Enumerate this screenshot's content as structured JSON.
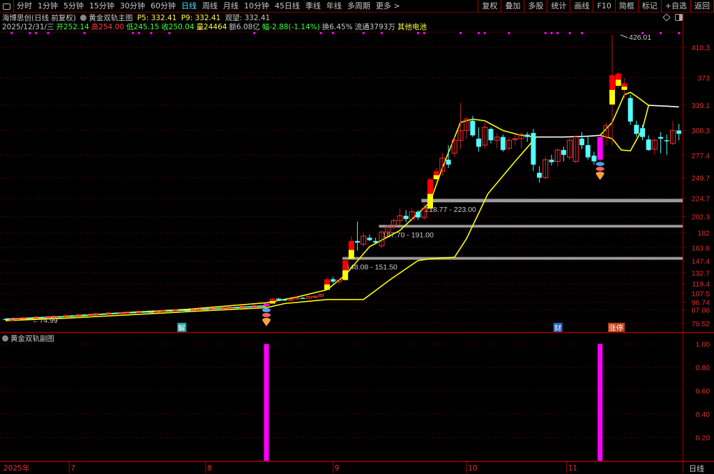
{
  "toolbar": {
    "periods": [
      "分时",
      "1分钟",
      "5分钟",
      "15分钟",
      "30分钟",
      "60分钟",
      "日线",
      "周线",
      "月线",
      "10分钟",
      "45日线",
      "季线",
      "年线",
      "多周期",
      "更多 >"
    ],
    "active": "日线",
    "actions": [
      "复权",
      "叠加",
      "多股",
      "统计",
      "画线",
      "F10",
      "简框",
      "标记",
      "+自选",
      "返回"
    ]
  },
  "header": {
    "stock": "海博思创(日线 前复权)",
    "indicator": "黄金双轨主图",
    "p5": "P5: 332.41",
    "p9": "P9: 332.41",
    "watch": "观望: 332.41",
    "date": "2025/12/31/三",
    "open": "开252.14",
    "high": "高254.00",
    "low": "低245.15",
    "close": "收250.04",
    "volume": "量24464",
    "amount": "额6.08亿",
    "change": "幅-2.88(-1.14%)",
    "turnover": "换6.45%",
    "float": "流通3793万",
    "concept": "其他电池"
  },
  "price_axis": {
    "ticks": [
      410.3,
      373.0,
      339.1,
      308.3,
      277.4,
      249.7,
      224.7,
      202.3,
      182.0,
      163.8,
      147.4,
      132.7,
      119.4,
      107.5,
      96.74,
      87.06,
      70.52
    ],
    "scale": "linear"
  },
  "sub_chart": {
    "title": "黄金双轨副图",
    "ticks": [
      "1.00",
      "0.80",
      "0.60",
      "0.40",
      "0.20"
    ],
    "bar_value": 1.0,
    "bar_indices": [
      43,
      98
    ],
    "bar_color": "#ff00ff"
  },
  "time_axis": {
    "labels": [
      {
        "text": "2025年",
        "i": -1
      },
      {
        "text": "7",
        "i": 10.5
      },
      {
        "text": "8",
        "i": 33
      },
      {
        "text": "9",
        "i": 54
      },
      {
        "text": "10",
        "i": 76
      },
      {
        "text": "11",
        "i": 92.5
      }
    ],
    "period": "日线"
  },
  "annotations": {
    "low": "←74.99",
    "high": "426.01",
    "events": [
      {
        "text": "解",
        "i": 29,
        "color": "#20a0a0"
      },
      {
        "text": "财",
        "i": 91,
        "color": "#2060c0"
      },
      {
        "text": "涨停",
        "i": 100,
        "color": "#c04010"
      }
    ]
  },
  "zones": [
    {
      "label": "148.08 - 151.50",
      "low": 148.08,
      "high": 151.5,
      "from": 56
    },
    {
      "label": "187.70 - 191.00",
      "low": 187.7,
      "high": 191.0,
      "from": 62
    },
    {
      "label": "218.77 - 223.00",
      "low": 218.77,
      "high": 223.0,
      "from": 69
    }
  ],
  "colors": {
    "up": "#ff3232",
    "down": "#54fcfc",
    "signal_top": "#ff0000",
    "signal_bottom": "#ffff00",
    "magenta": "#ff00ff",
    "band": "#ffff00",
    "watch_line": "#ffffff",
    "grid": "#8a0000",
    "axis_text": "#e03030"
  },
  "signal_dots": [
    1,
    4,
    5,
    7,
    13,
    21,
    22,
    24,
    27,
    41,
    52,
    54,
    59,
    62,
    68,
    69,
    75,
    78,
    79,
    83,
    89,
    90,
    91,
    93,
    95,
    105,
    108,
    111
  ],
  "signals": {
    "red_yellow": [
      44,
      53,
      56,
      57,
      70,
      71,
      100,
      101,
      102
    ],
    "magenta": [
      43,
      98
    ]
  },
  "candles": [
    [
      76,
      77,
      75,
      75.5
    ],
    [
      75.5,
      76,
      74.99,
      75.8
    ],
    [
      75.8,
      77,
      75.5,
      76.5
    ],
    [
      76.5,
      78,
      76,
      77.5
    ],
    [
      77.5,
      78,
      76.5,
      77
    ],
    [
      77,
      79,
      76.8,
      78.5
    ],
    [
      78.5,
      79,
      77.5,
      78
    ],
    [
      78,
      79.5,
      77.8,
      79
    ],
    [
      79,
      80,
      78.5,
      79.5
    ],
    [
      79.5,
      80,
      78.8,
      79.2
    ],
    [
      79.2,
      81,
      79,
      80.5
    ],
    [
      80.5,
      81,
      80,
      80.2
    ],
    [
      80.2,
      82,
      80,
      81.5
    ],
    [
      81.5,
      82,
      80.8,
      81
    ],
    [
      81,
      82.5,
      80.8,
      82
    ],
    [
      82,
      83,
      81.5,
      82.5
    ],
    [
      82.5,
      83,
      81.8,
      82
    ],
    [
      82,
      84,
      81.8,
      83.5
    ],
    [
      83.5,
      84,
      82.5,
      83
    ],
    [
      83,
      84.5,
      82.8,
      84
    ],
    [
      84,
      85,
      83.5,
      84.5
    ],
    [
      84.5,
      85,
      83.8,
      84
    ],
    [
      84,
      86,
      83.8,
      85.5
    ],
    [
      85.5,
      86,
      84.5,
      85
    ],
    [
      85,
      86,
      84,
      84.5
    ],
    [
      84.5,
      86.5,
      84.2,
      86
    ],
    [
      86,
      87,
      85.5,
      86.5
    ],
    [
      86.5,
      87,
      85.5,
      86
    ],
    [
      86,
      88,
      85.8,
      87.5
    ],
    [
      87.5,
      88,
      86.5,
      87
    ],
    [
      87,
      88,
      86,
      86.5
    ],
    [
      86.5,
      88.5,
      86.2,
      88
    ],
    [
      88,
      89,
      87.5,
      88.5
    ],
    [
      88.5,
      89,
      87.5,
      88
    ],
    [
      88,
      90,
      87.8,
      89.5
    ],
    [
      89.5,
      90,
      88.5,
      89
    ],
    [
      89,
      90.5,
      88.5,
      90
    ],
    [
      90,
      91,
      89.5,
      90.5
    ],
    [
      90.5,
      91,
      89.5,
      90
    ],
    [
      90,
      92,
      89.8,
      91.5
    ],
    [
      91.5,
      92,
      90.5,
      91
    ],
    [
      91,
      93,
      90.5,
      92.5
    ],
    [
      92.5,
      93,
      91.5,
      92
    ],
    [
      92,
      96,
      91.5,
      95
    ],
    [
      95,
      102,
      95,
      101
    ],
    [
      101,
      102,
      99,
      100
    ],
    [
      100,
      101,
      98,
      99
    ],
    [
      99,
      101,
      98,
      100.5
    ],
    [
      100.5,
      103,
      100,
      102
    ],
    [
      102,
      103,
      101,
      101.5
    ],
    [
      101.5,
      104,
      101,
      103.5
    ],
    [
      103.5,
      105,
      102.5,
      104
    ],
    [
      104,
      107,
      103,
      106
    ],
    [
      112,
      126,
      111,
      125
    ],
    [
      125,
      128,
      120,
      122
    ],
    [
      122,
      126,
      119,
      124
    ],
    [
      124,
      150,
      123,
      148
    ],
    [
      150,
      178,
      148,
      172
    ],
    [
      172,
      196,
      160,
      170
    ],
    [
      168,
      182,
      165,
      178
    ],
    [
      176,
      180,
      172,
      173
    ],
    [
      172,
      176,
      168,
      170
    ],
    [
      166,
      185,
      163,
      183
    ],
    [
      183,
      192,
      180,
      190
    ],
    [
      190,
      200,
      186,
      197
    ],
    [
      197,
      212,
      192,
      203
    ],
    [
      203,
      210,
      195,
      199
    ],
    [
      199,
      212,
      196,
      208
    ],
    [
      208,
      210,
      198,
      201
    ],
    [
      201,
      218,
      198,
      212
    ],
    [
      212,
      250,
      210,
      248
    ],
    [
      248,
      262,
      244,
      258
    ],
    [
      258,
      280,
      252,
      274
    ],
    [
      272,
      290,
      262,
      266
    ],
    [
      280,
      300,
      275,
      296
    ],
    [
      296,
      342,
      285,
      308
    ],
    [
      308,
      325,
      298,
      322
    ],
    [
      320,
      326,
      300,
      302
    ],
    [
      298,
      312,
      282,
      288
    ],
    [
      290,
      318,
      286,
      312
    ],
    [
      310,
      312,
      292,
      296
    ],
    [
      296,
      305,
      286,
      300
    ],
    [
      300,
      303,
      282,
      284
    ],
    [
      286,
      300,
      283,
      296
    ],
    [
      297,
      303,
      290,
      298
    ],
    [
      298,
      306,
      286,
      303
    ],
    [
      303,
      306,
      294,
      300
    ],
    [
      305,
      310,
      258,
      266
    ],
    [
      256,
      264,
      244,
      250
    ],
    [
      250,
      276,
      248,
      272
    ],
    [
      272,
      278,
      265,
      269
    ],
    [
      270,
      286,
      264,
      284
    ],
    [
      284,
      288,
      270,
      278
    ],
    [
      275,
      300,
      272,
      296
    ],
    [
      270,
      302,
      268,
      300
    ],
    [
      298,
      306,
      285,
      290
    ],
    [
      290,
      302,
      272,
      275
    ],
    [
      277,
      282,
      266,
      270
    ],
    [
      272,
      302,
      270,
      300
    ],
    [
      300,
      318,
      290,
      314
    ],
    [
      340,
      426.01,
      290,
      376
    ],
    [
      363,
      380,
      360,
      378
    ],
    [
      358,
      372,
      348,
      366
    ],
    [
      348,
      352,
      315,
      319
    ],
    [
      315,
      320,
      300,
      304
    ],
    [
      311,
      315,
      296,
      300
    ],
    [
      297,
      302,
      283,
      284
    ],
    [
      285,
      298,
      278,
      296
    ],
    [
      300,
      306,
      280,
      298
    ],
    [
      296,
      303,
      278,
      295
    ],
    [
      292,
      320,
      290,
      308
    ],
    [
      308,
      316,
      296,
      304
    ]
  ],
  "lines": {
    "watch": [
      [
        [
          0,
          76
        ],
        [
          10,
          79
        ],
        [
          20,
          83.5
        ],
        [
          30,
          87
        ],
        [
          43,
          92
        ]
      ],
      [
        [
          87.5,
          300
        ],
        [
          92,
          300
        ],
        [
          96,
          301
        ],
        [
          98,
          302
        ]
      ],
      [
        [
          106,
          339
        ],
        [
          109,
          338
        ],
        [
          111,
          337
        ]
      ]
    ],
    "upper": [
      [
        0,
        75
      ],
      [
        10,
        79
      ],
      [
        20,
        84
      ],
      [
        30,
        88
      ],
      [
        43,
        96
      ],
      [
        48,
        103
      ],
      [
        53,
        112
      ],
      [
        56,
        130
      ],
      [
        60,
        165
      ],
      [
        65,
        185
      ],
      [
        70,
        220
      ],
      [
        72,
        262
      ],
      [
        75,
        318
      ],
      [
        77,
        322
      ],
      [
        79,
        320
      ],
      [
        82,
        308
      ],
      [
        85,
        302
      ],
      [
        87.5,
        300
      ]
    ],
    "lower": [
      [
        0,
        74
      ],
      [
        10,
        77
      ],
      [
        20,
        81
      ],
      [
        30,
        85
      ],
      [
        43,
        90
      ],
      [
        46,
        95
      ],
      [
        53,
        100
      ],
      [
        59,
        100
      ],
      [
        63.5,
        125
      ],
      [
        68,
        148
      ],
      [
        70,
        150
      ],
      [
        74,
        152
      ],
      [
        76,
        175
      ],
      [
        79.5,
        230
      ],
      [
        84,
        270
      ],
      [
        87.5,
        300
      ]
    ],
    "upper2": [
      [
        98,
        302
      ],
      [
        100,
        318
      ],
      [
        102,
        352
      ],
      [
        103,
        355
      ],
      [
        104,
        350
      ],
      [
        106,
        339
      ]
    ],
    "lower2": [
      [
        98,
        302
      ],
      [
        100,
        298
      ],
      [
        101.5,
        284
      ],
      [
        103,
        283
      ],
      [
        105,
        310
      ],
      [
        106,
        339
      ]
    ]
  }
}
